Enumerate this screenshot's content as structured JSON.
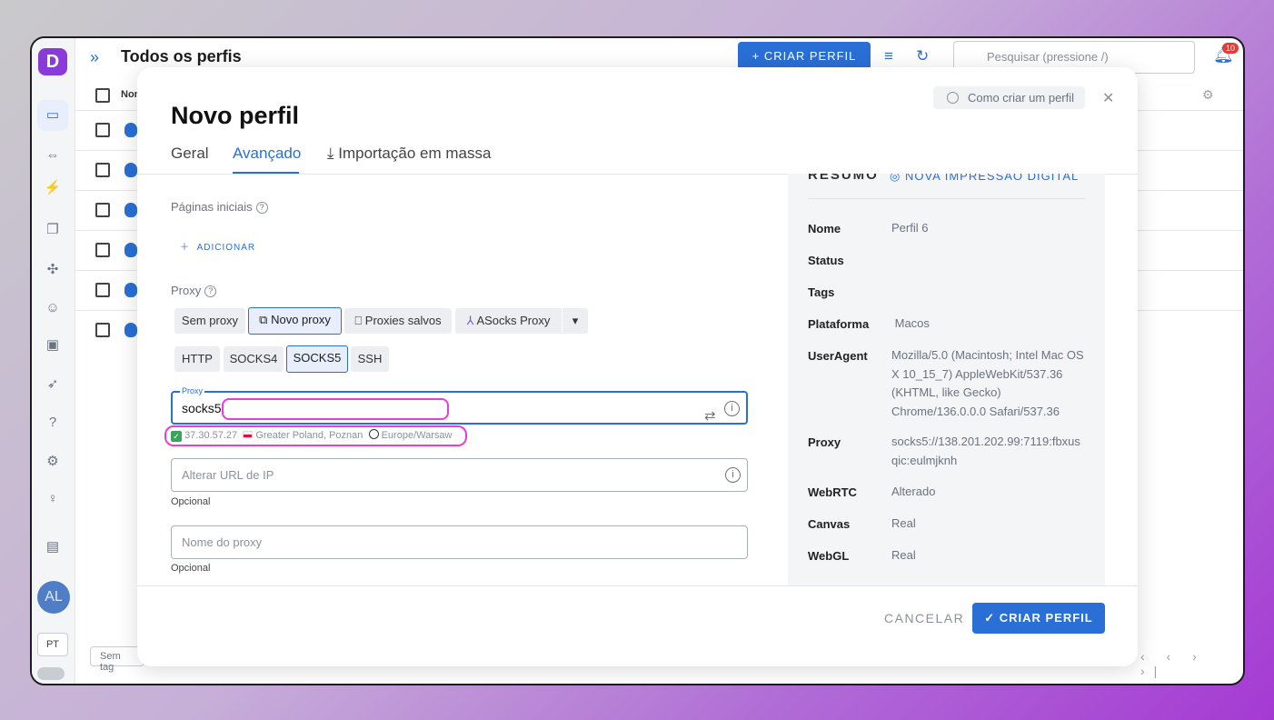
{
  "app": {
    "logo_letter": "D",
    "title": "Todos os perfis",
    "create_profile_label": "+ CRIAR PERFIL",
    "search_placeholder": "Pesquisar (pressione /)",
    "notification_count": "10",
    "table_header_name": "Nom",
    "avatar_initials": "AL",
    "language": "PT",
    "tags_filter": "Sem tag",
    "pager": "‹ ‹ › ›|"
  },
  "modal": {
    "title": "Novo perfil",
    "help_label": "Como criar um perfil",
    "tabs": [
      {
        "label": "Geral"
      },
      {
        "label": "Avançado"
      },
      {
        "label": "Importação em massa"
      }
    ],
    "start_pages_label": "Páginas iniciais",
    "add_label": "ADICIONAR",
    "proxy_label": "Proxy",
    "proxy_modes": [
      "Sem proxy",
      "Novo proxy",
      "Proxies salvos",
      "ASocks Proxy"
    ],
    "proxy_types": [
      "HTTP",
      "SOCKS4",
      "SOCKS5",
      "SSH"
    ],
    "proxy_field": {
      "legend": "Proxy",
      "value": "socks5:"
    },
    "proxy_check": {
      "ip": "37.30.57.27",
      "location": "Greater Poland, Poznan",
      "timezone": "Europe/Warsaw"
    },
    "change_ip_url_placeholder": "Alterar URL de IP",
    "optional_label": "Opcional",
    "proxy_name_placeholder": "Nome do proxy",
    "cancel_label": "CANCELAR",
    "submit_label": "✓ CRIAR PERFIL"
  },
  "summary": {
    "heading": "RESUMO",
    "new_fingerprint": "NOVA IMPRESSÃO DIGITAL",
    "rows": [
      {
        "key": "Nome",
        "value": "Perfil 6"
      },
      {
        "key": "Status",
        "value": ""
      },
      {
        "key": "Tags",
        "value": ""
      },
      {
        "key": "Plataforma",
        "value": "Macos"
      },
      {
        "key": "UserAgent",
        "value": "Mozilla/5.0 (Macintosh; Intel Mac OS X 10_15_7) AppleWebKit/537.36 (KHTML, like Gecko) Chrome/136.0.0.0 Safari/537.36"
      },
      {
        "key": "Proxy",
        "value": "socks5://138.201.202.99:7119:fbxusqic:eulmjknh"
      },
      {
        "key": "WebRTC",
        "value": "Alterado"
      },
      {
        "key": "Canvas",
        "value": "Real"
      },
      {
        "key": "WebGL",
        "value": "Real"
      }
    ]
  },
  "colors": {
    "accent": "#2a6fd6",
    "highlight": "#e63fd6",
    "brand": "#8a3ad6"
  }
}
